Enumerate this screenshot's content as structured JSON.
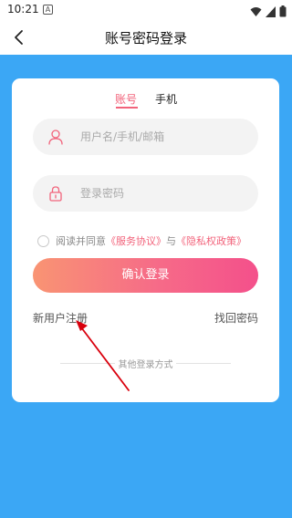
{
  "status_bar": {
    "time": "10:21",
    "notification_badge": "A"
  },
  "nav": {
    "title": "账号密码登录",
    "back_icon": "chevron-left-icon"
  },
  "tabs": [
    {
      "label": "账号",
      "active": true
    },
    {
      "label": "手机",
      "active": false
    }
  ],
  "form": {
    "username_placeholder": "用户名/手机/邮箱",
    "username_icon": "user-icon",
    "password_placeholder": "登录密码",
    "password_icon": "lock-icon",
    "agree": {
      "prefix": "阅读并同意",
      "service_link": "《服务协议》",
      "connector": "与",
      "privacy_link": "《隐私权政策》",
      "checked": false
    },
    "submit_label": "确认登录"
  },
  "links": {
    "register": "新用户注册",
    "forgot_password": "找回密码"
  },
  "other_login": {
    "label": "其他登录方式"
  },
  "colors": {
    "accent": "#f2637b",
    "background_blue": "#3ba7f5",
    "button_gradient_start": "#f99473",
    "button_gradient_end": "#f4508b",
    "annotation_arrow": "#d9000d"
  }
}
